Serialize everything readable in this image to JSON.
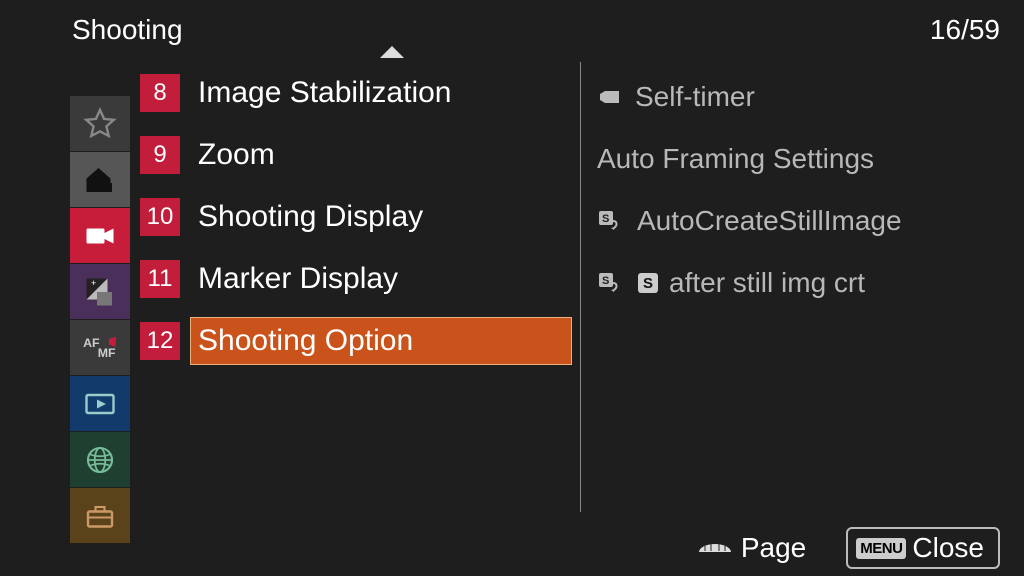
{
  "header": {
    "title": "Shooting",
    "page_indicator": "16/59"
  },
  "rail": {
    "items": [
      {
        "name": "favorites",
        "icon": "star"
      },
      {
        "name": "main",
        "icon": "home"
      },
      {
        "name": "shooting",
        "icon": "video",
        "active": true
      },
      {
        "name": "exposure",
        "icon": "exposure"
      },
      {
        "name": "focus",
        "icon": "af-mf"
      },
      {
        "name": "playback",
        "icon": "play"
      },
      {
        "name": "network",
        "icon": "globe"
      },
      {
        "name": "setup",
        "icon": "toolbox"
      }
    ]
  },
  "list": {
    "items": [
      {
        "num": "8",
        "label": "Image Stabilization"
      },
      {
        "num": "9",
        "label": "Zoom"
      },
      {
        "num": "10",
        "label": "Shooting Display"
      },
      {
        "num": "11",
        "label": "Marker Display"
      },
      {
        "num": "12",
        "label": "Shooting Option",
        "selected": true
      }
    ]
  },
  "detail": {
    "items": [
      {
        "icon": "selftimer",
        "label": "Self-timer"
      },
      {
        "icon": "",
        "label": "Auto Framing Settings"
      },
      {
        "icon": "sq",
        "label": "AutoCreateStillImage"
      },
      {
        "icon": "sqs",
        "label": "after still img crt"
      }
    ]
  },
  "footer": {
    "page_label": "Page",
    "close_label": "Close",
    "menu_chip": "MENU"
  }
}
